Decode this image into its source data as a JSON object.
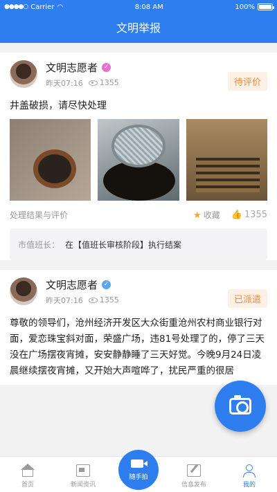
{
  "status_bar": {
    "carrier": "Carrier",
    "time": "8:08 AM",
    "battery": "100%",
    "battery_level": 1.0
  },
  "nav": {
    "title": "文明举报"
  },
  "posts": [
    {
      "user_name": "文明志愿者",
      "badge_color": "#e66fd0",
      "time": "昨天07:16",
      "views": "1355",
      "status": "待评价",
      "text": "井盖破损，请尽快处理",
      "result_label": "处理结果与评价",
      "favorite_label": "收藏",
      "likes": "1355",
      "review_label": "市值班长：",
      "review_text": "在【值班长审核阶段】执行结案"
    },
    {
      "user_name": "文明志愿者",
      "badge_color": "#5aa9ee",
      "time": "昨天07:16",
      "views": "1355",
      "status": "已派遣",
      "text": "尊敬的领导们，沧州经济开发区大众街重沧州农村商业银行对面，爱恋珠宝斜对面，荣盛广场，违81号处理了的，停了三天没在广场摆夜宵摊，安安静静睡了三天好觉。今晚9月24日凌晨继续摆夜宵摊，又开始大声喧哗了，扰民严重的很居"
    }
  ],
  "tabs": [
    {
      "label": "首页",
      "icon": "home-icon"
    },
    {
      "label": "新闻资讯",
      "icon": "news-icon"
    },
    {
      "label": "随手拍",
      "icon": "video-icon"
    },
    {
      "label": "信息发布",
      "icon": "edit-icon"
    },
    {
      "label": "我的",
      "icon": "user-icon"
    }
  ],
  "colors": {
    "primary": "#2f7ef0",
    "status_orange": "#f08a3c"
  }
}
